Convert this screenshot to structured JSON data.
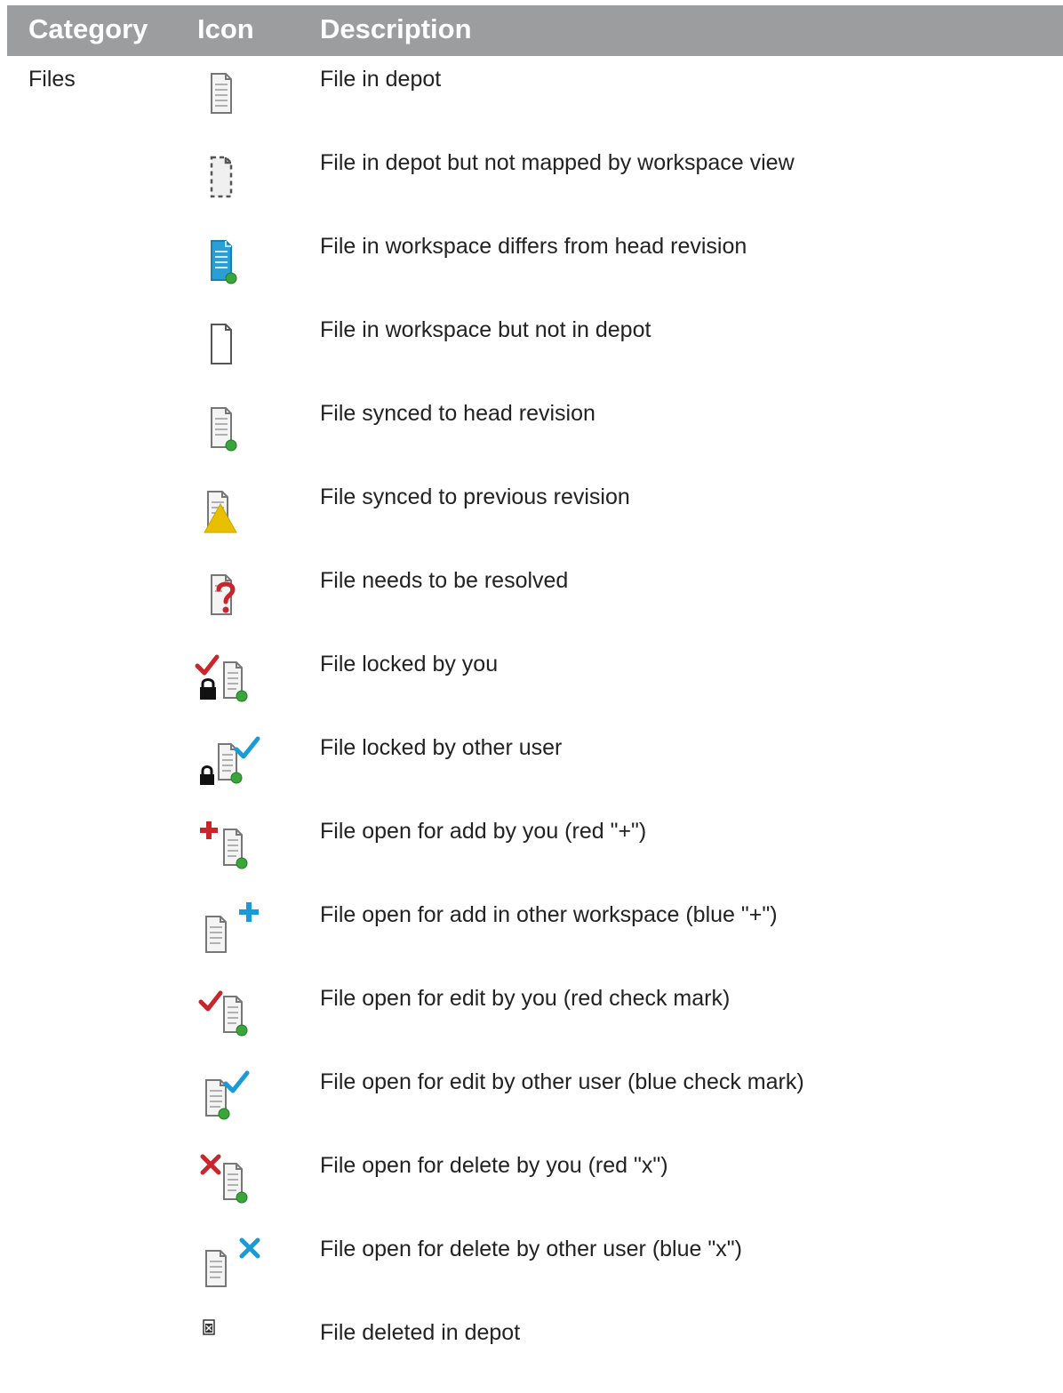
{
  "header": {
    "category": "Category",
    "icon": "Icon",
    "description": "Description"
  },
  "rows": [
    {
      "category": "Files",
      "icon": "file-in-depot-icon",
      "description": "File in depot"
    },
    {
      "category": "",
      "icon": "file-unmapped-icon",
      "description": "File in depot but not mapped by workspace view"
    },
    {
      "category": "",
      "icon": "file-differs-icon",
      "description": "File in workspace differs from head revision"
    },
    {
      "category": "",
      "icon": "file-not-in-depot-icon",
      "description": "File in workspace but not in depot"
    },
    {
      "category": "",
      "icon": "file-synced-head-icon",
      "description": "File synced to head revision"
    },
    {
      "category": "",
      "icon": "file-synced-previous-icon",
      "description": "File synced to previous revision"
    },
    {
      "category": "",
      "icon": "file-needs-resolve-icon",
      "description": "File needs to be resolved"
    },
    {
      "category": "",
      "icon": "file-locked-by-you-icon",
      "description": "File locked by you"
    },
    {
      "category": "",
      "icon": "file-locked-by-other-icon",
      "description": "File locked by other user"
    },
    {
      "category": "",
      "icon": "file-add-by-you-icon",
      "description": "File open for add by you (red \"+\")"
    },
    {
      "category": "",
      "icon": "file-add-other-icon",
      "description": "File open for add in other workspace (blue \"+\")"
    },
    {
      "category": "",
      "icon": "file-edit-by-you-icon",
      "description": "File open for edit by you (red check mark)"
    },
    {
      "category": "",
      "icon": "file-edit-other-icon",
      "description": "File open for edit by other user (blue check mark)"
    },
    {
      "category": "",
      "icon": "file-delete-by-you-icon",
      "description": "File open for delete by you (red \"x\")"
    },
    {
      "category": "",
      "icon": "file-delete-other-icon",
      "description": "File open for delete by other user (blue \"x\")"
    },
    {
      "category": "",
      "icon": "file-deleted-icon",
      "description": "File deleted in depot"
    }
  ],
  "colors": {
    "header_bg": "#9b9d9f",
    "red": "#c8262c",
    "blue": "#1a9ad6",
    "green": "#3aa53a",
    "yellow": "#e8c000"
  }
}
